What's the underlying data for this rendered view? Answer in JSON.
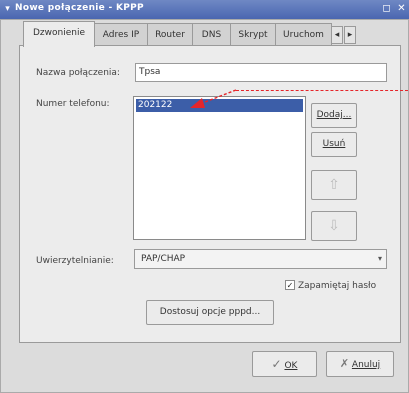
{
  "window": {
    "title": "Nowe połączenie - KPPP",
    "menu_glyph": "▾",
    "restore_glyph": "◻",
    "close_glyph": "✕"
  },
  "tabs": [
    "Dzwonienie",
    "Adres IP",
    "Router",
    "DNS",
    "Skrypt",
    "Uruchom"
  ],
  "tab_scroll": {
    "left": "◂",
    "right": "▸"
  },
  "form": {
    "connection_name_label": "Nazwa połączenia:",
    "connection_name_value": "Tpsa",
    "phone_label": "Numer telefonu:",
    "phone_numbers": [
      "202122"
    ],
    "add_button": "Dodaj...",
    "remove_button": "Usuń",
    "up_arrow": "⇧",
    "down_arrow": "⇩",
    "auth_label": "Uwierzytelnianie:",
    "auth_value": "PAP/CHAP",
    "combo_arrow": "▾",
    "remember_password_label": "Zapamiętaj hasło",
    "remember_password_checked": true,
    "check_glyph": "✓",
    "pppd_button": "Dostosuj opcje pppd..."
  },
  "footer": {
    "ok_icon": "✓",
    "ok_label": "OK",
    "cancel_icon": "✗",
    "cancel_label": "Anuluj"
  },
  "colors": {
    "titlebar": "#5470b8",
    "selection": "#3c5ea8",
    "annotation": "#e5252a"
  }
}
